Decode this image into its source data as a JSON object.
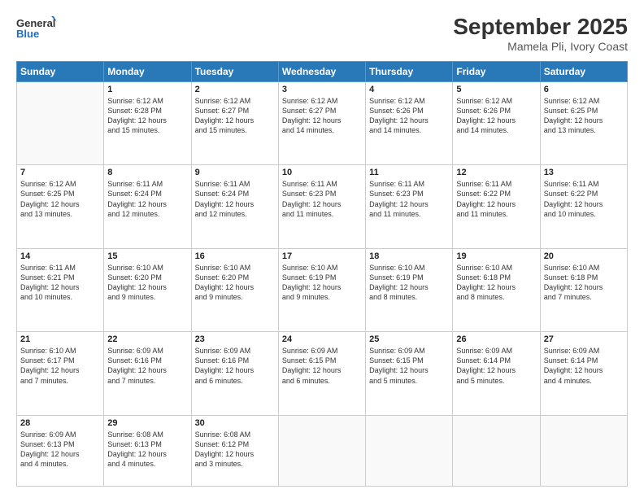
{
  "logo": {
    "line1": "General",
    "line2": "Blue"
  },
  "header": {
    "title": "September 2025",
    "subtitle": "Mamela Pli, Ivory Coast"
  },
  "weekdays": [
    "Sunday",
    "Monday",
    "Tuesday",
    "Wednesday",
    "Thursday",
    "Friday",
    "Saturday"
  ],
  "weeks": [
    [
      {
        "day": "",
        "info": ""
      },
      {
        "day": "1",
        "info": "Sunrise: 6:12 AM\nSunset: 6:28 PM\nDaylight: 12 hours\nand 15 minutes."
      },
      {
        "day": "2",
        "info": "Sunrise: 6:12 AM\nSunset: 6:27 PM\nDaylight: 12 hours\nand 15 minutes."
      },
      {
        "day": "3",
        "info": "Sunrise: 6:12 AM\nSunset: 6:27 PM\nDaylight: 12 hours\nand 14 minutes."
      },
      {
        "day": "4",
        "info": "Sunrise: 6:12 AM\nSunset: 6:26 PM\nDaylight: 12 hours\nand 14 minutes."
      },
      {
        "day": "5",
        "info": "Sunrise: 6:12 AM\nSunset: 6:26 PM\nDaylight: 12 hours\nand 14 minutes."
      },
      {
        "day": "6",
        "info": "Sunrise: 6:12 AM\nSunset: 6:25 PM\nDaylight: 12 hours\nand 13 minutes."
      }
    ],
    [
      {
        "day": "7",
        "info": "Sunrise: 6:12 AM\nSunset: 6:25 PM\nDaylight: 12 hours\nand 13 minutes."
      },
      {
        "day": "8",
        "info": "Sunrise: 6:11 AM\nSunset: 6:24 PM\nDaylight: 12 hours\nand 12 minutes."
      },
      {
        "day": "9",
        "info": "Sunrise: 6:11 AM\nSunset: 6:24 PM\nDaylight: 12 hours\nand 12 minutes."
      },
      {
        "day": "10",
        "info": "Sunrise: 6:11 AM\nSunset: 6:23 PM\nDaylight: 12 hours\nand 11 minutes."
      },
      {
        "day": "11",
        "info": "Sunrise: 6:11 AM\nSunset: 6:23 PM\nDaylight: 12 hours\nand 11 minutes."
      },
      {
        "day": "12",
        "info": "Sunrise: 6:11 AM\nSunset: 6:22 PM\nDaylight: 12 hours\nand 11 minutes."
      },
      {
        "day": "13",
        "info": "Sunrise: 6:11 AM\nSunset: 6:22 PM\nDaylight: 12 hours\nand 10 minutes."
      }
    ],
    [
      {
        "day": "14",
        "info": "Sunrise: 6:11 AM\nSunset: 6:21 PM\nDaylight: 12 hours\nand 10 minutes."
      },
      {
        "day": "15",
        "info": "Sunrise: 6:10 AM\nSunset: 6:20 PM\nDaylight: 12 hours\nand 9 minutes."
      },
      {
        "day": "16",
        "info": "Sunrise: 6:10 AM\nSunset: 6:20 PM\nDaylight: 12 hours\nand 9 minutes."
      },
      {
        "day": "17",
        "info": "Sunrise: 6:10 AM\nSunset: 6:19 PM\nDaylight: 12 hours\nand 9 minutes."
      },
      {
        "day": "18",
        "info": "Sunrise: 6:10 AM\nSunset: 6:19 PM\nDaylight: 12 hours\nand 8 minutes."
      },
      {
        "day": "19",
        "info": "Sunrise: 6:10 AM\nSunset: 6:18 PM\nDaylight: 12 hours\nand 8 minutes."
      },
      {
        "day": "20",
        "info": "Sunrise: 6:10 AM\nSunset: 6:18 PM\nDaylight: 12 hours\nand 7 minutes."
      }
    ],
    [
      {
        "day": "21",
        "info": "Sunrise: 6:10 AM\nSunset: 6:17 PM\nDaylight: 12 hours\nand 7 minutes."
      },
      {
        "day": "22",
        "info": "Sunrise: 6:09 AM\nSunset: 6:16 PM\nDaylight: 12 hours\nand 7 minutes."
      },
      {
        "day": "23",
        "info": "Sunrise: 6:09 AM\nSunset: 6:16 PM\nDaylight: 12 hours\nand 6 minutes."
      },
      {
        "day": "24",
        "info": "Sunrise: 6:09 AM\nSunset: 6:15 PM\nDaylight: 12 hours\nand 6 minutes."
      },
      {
        "day": "25",
        "info": "Sunrise: 6:09 AM\nSunset: 6:15 PM\nDaylight: 12 hours\nand 5 minutes."
      },
      {
        "day": "26",
        "info": "Sunrise: 6:09 AM\nSunset: 6:14 PM\nDaylight: 12 hours\nand 5 minutes."
      },
      {
        "day": "27",
        "info": "Sunrise: 6:09 AM\nSunset: 6:14 PM\nDaylight: 12 hours\nand 4 minutes."
      }
    ],
    [
      {
        "day": "28",
        "info": "Sunrise: 6:09 AM\nSunset: 6:13 PM\nDaylight: 12 hours\nand 4 minutes."
      },
      {
        "day": "29",
        "info": "Sunrise: 6:08 AM\nSunset: 6:13 PM\nDaylight: 12 hours\nand 4 minutes."
      },
      {
        "day": "30",
        "info": "Sunrise: 6:08 AM\nSunset: 6:12 PM\nDaylight: 12 hours\nand 3 minutes."
      },
      {
        "day": "",
        "info": ""
      },
      {
        "day": "",
        "info": ""
      },
      {
        "day": "",
        "info": ""
      },
      {
        "day": "",
        "info": ""
      }
    ]
  ]
}
